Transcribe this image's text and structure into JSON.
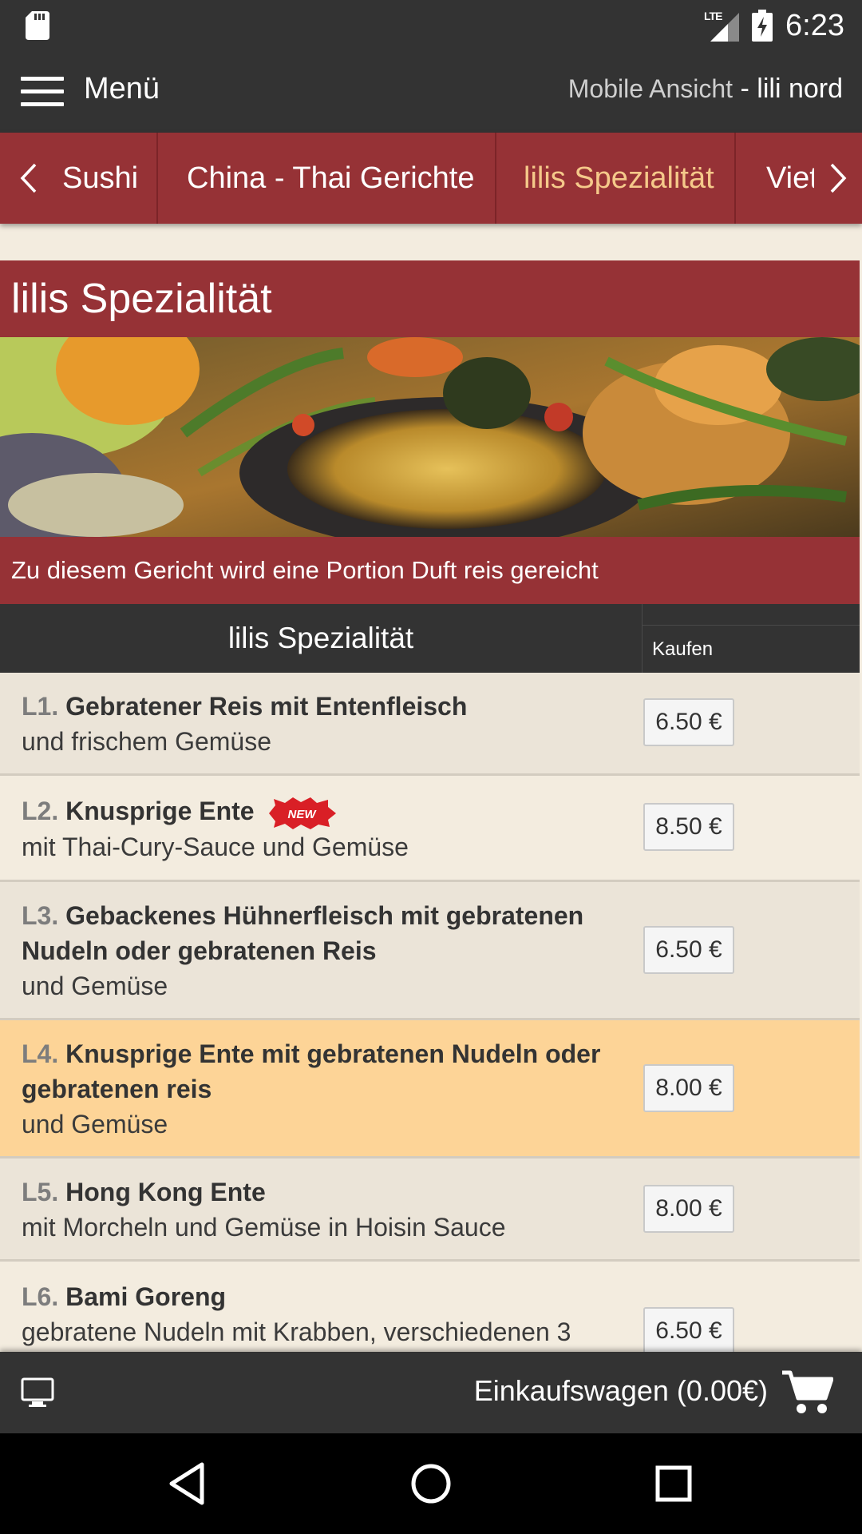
{
  "status_bar": {
    "time": "6:23",
    "network": "LTE"
  },
  "app_bar": {
    "menu_label": "Menü",
    "view_mode": "Mobile Ansicht",
    "separator": " - ",
    "restaurant": "lili nord"
  },
  "tabs": [
    {
      "label": "Sushi"
    },
    {
      "label": "China - Thai Gerichte"
    },
    {
      "label": "lilis Spezialität",
      "active": true
    },
    {
      "label": "Vietnam"
    }
  ],
  "section": {
    "title": "lilis Spezialität",
    "subtitle": "Zu diesem Gericht wird eine Portion Duft reis gereicht"
  },
  "table": {
    "header_title": "lilis Spezialität",
    "header_buy": "Kaufen",
    "items": [
      {
        "code": "L1.",
        "name": "Gebratener Reis mit Entenfleisch",
        "desc": "und frischem Gemüse",
        "price": "6.50 €"
      },
      {
        "code": "L2.",
        "name": "Knusprige Ente",
        "badge": "NEW",
        "desc": "mit Thai-Cury-Sauce und Gemüse",
        "price": "8.50 €"
      },
      {
        "code": "L3.",
        "name": "Gebackenes Hühnerfleisch mit gebratenen Nudeln oder gebratenen Reis",
        "desc": "und Gemüse",
        "price": "6.50 €"
      },
      {
        "code": "L4.",
        "name": "Knusprige Ente mit gebratenen Nudeln oder gebratenen reis",
        "desc": "und Gemüse",
        "price": "8.00 €",
        "highlight": true
      },
      {
        "code": "L5.",
        "name": "Hong Kong Ente",
        "desc": "mit Morcheln und Gemüse in Hoisin Sauce",
        "price": "8.00 €"
      },
      {
        "code": "L6.",
        "name": "Bami Goreng",
        "desc": "gebratene Nudeln mit Krabben, verschiedenen 3",
        "price": "6.50 €"
      }
    ]
  },
  "cart": {
    "label": "Einkaufswagen (0.00€)"
  },
  "icons": {
    "sd_card": "sd-card-icon",
    "signal": "signal-icon",
    "battery": "battery-charging-icon",
    "menu": "hamburger-icon",
    "prev": "chevron-left-icon",
    "next": "chevron-right-icon",
    "desktop": "desktop-icon",
    "cart": "shopping-cart-icon",
    "back": "nav-back-icon",
    "home": "nav-home-icon",
    "recents": "nav-recents-icon"
  },
  "colors": {
    "brand": "#963236",
    "dark": "#333333",
    "active_tab": "#f5c98a",
    "highlight_row": "#fdd497",
    "row_a": "#ebe4d8",
    "row_b": "#f3ecdf"
  }
}
